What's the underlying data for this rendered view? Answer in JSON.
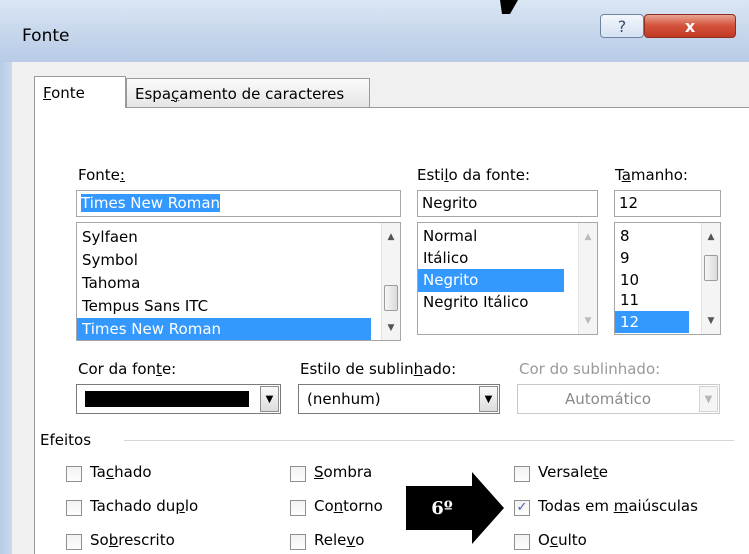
{
  "window": {
    "title": "Fonte",
    "help_label": "?",
    "close_label": "x"
  },
  "tabs": [
    {
      "label": "Fonte",
      "mnemonic": "F",
      "active": true
    },
    {
      "label": "Espaçamento de caracteres",
      "mnemonic": "ç",
      "active": false
    }
  ],
  "font": {
    "label": "Fonte:",
    "value": "Times New Roman",
    "items": [
      "Sylfaen",
      "Symbol",
      "Tahoma",
      "Tempus Sans ITC",
      "Times New Roman"
    ],
    "selected": "Times New Roman"
  },
  "style": {
    "label": "Estilo da fonte:",
    "value": "Negrito",
    "items": [
      "Normal",
      "Itálico",
      "Negrito",
      "Negrito Itálico"
    ],
    "selected": "Negrito"
  },
  "size": {
    "label": "Tamanho:",
    "value": "12",
    "items": [
      "8",
      "9",
      "10",
      "11",
      "12"
    ],
    "selected": "12"
  },
  "font_color": {
    "label": "Cor da fonte:",
    "value_color": "#000000"
  },
  "underline_style": {
    "label": "Estilo de sublinhado:",
    "value": "(nenhum)"
  },
  "underline_color": {
    "label": "Cor do sublinhado:",
    "value": "Automático"
  },
  "effects": {
    "label": "Efeitos",
    "items": [
      {
        "label": "Tachado",
        "checked": false
      },
      {
        "label": "Sombra",
        "checked": false
      },
      {
        "label": "Versalete",
        "checked": false
      },
      {
        "label": "Tachado duplo",
        "checked": false
      },
      {
        "label": "Contorno",
        "checked": false
      },
      {
        "label": "Todas em maiúsculas",
        "checked": true
      },
      {
        "label": "Sobrescrito",
        "checked": false
      },
      {
        "label": "Relevo",
        "checked": false
      },
      {
        "label": "Oculto",
        "checked": false
      }
    ]
  },
  "annotation": {
    "label": "6º"
  },
  "colors": {
    "selection": "#3399ff",
    "close_button": "#c9442c",
    "dialog_bg": "#f0f0f0"
  }
}
